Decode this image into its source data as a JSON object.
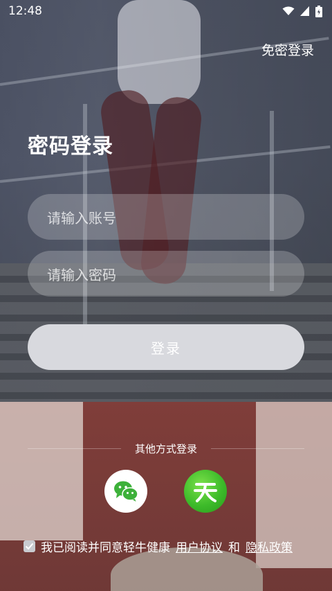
{
  "status_bar": {
    "time": "12:48",
    "icons": [
      "wifi-icon",
      "signal-icon",
      "battery-icon"
    ]
  },
  "header": {
    "top_link": "免密登录",
    "title": "密码登录"
  },
  "form": {
    "account_placeholder": "请输入账号",
    "password_placeholder": "请输入密码",
    "login_label": "登录"
  },
  "other_login": {
    "label": "其他方式登录",
    "options": [
      "wechat-icon",
      "tianyi-icon"
    ]
  },
  "agreement": {
    "prefix": "我已阅读并同意轻牛健康",
    "user_agreement": "用户协议",
    "connector": "和",
    "privacy_policy": "隐私政策",
    "checked": true
  },
  "colors": {
    "login_button": "#d8d9de",
    "wechat_green": "#3db13a",
    "tianyi_green": "#3dbb2a"
  }
}
